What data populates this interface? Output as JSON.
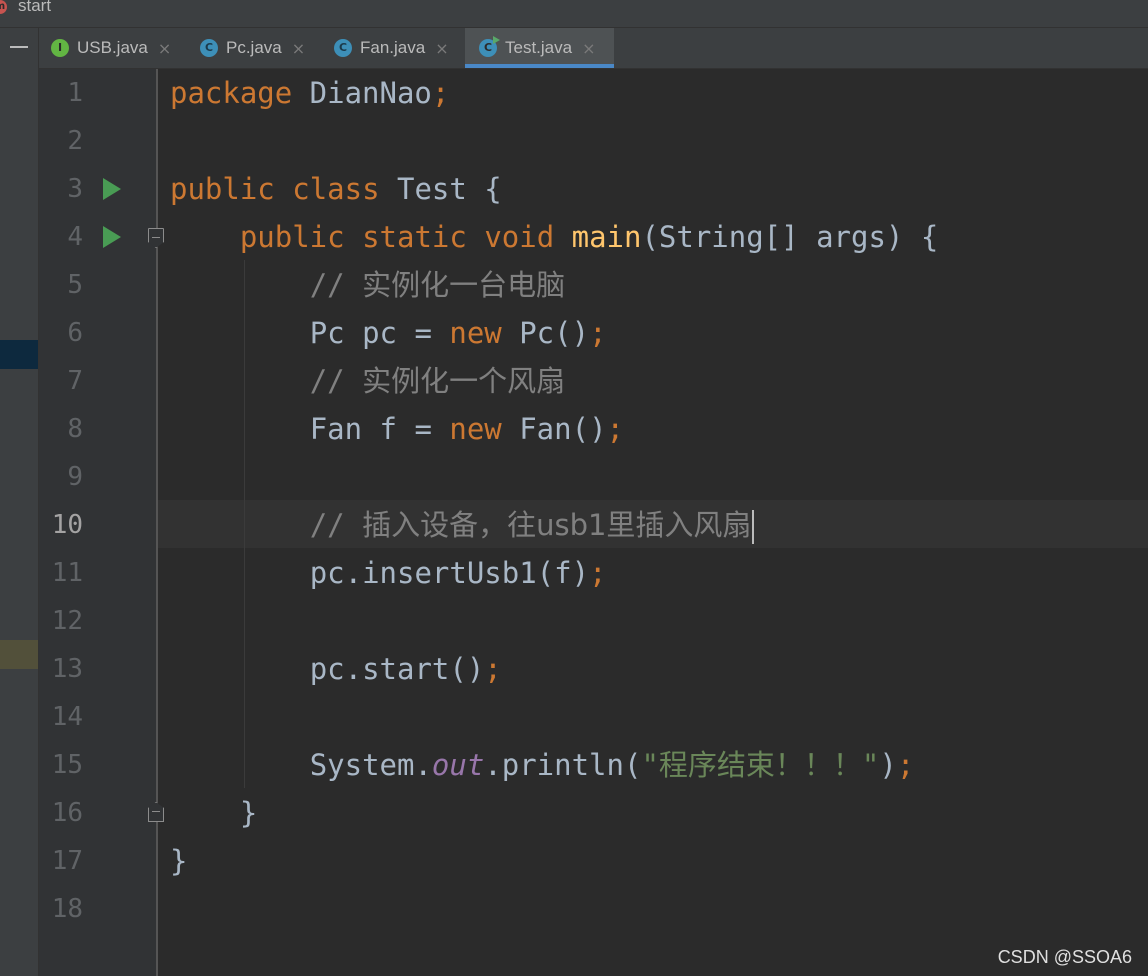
{
  "breadcrumb": {
    "label": "start",
    "icon": "method-icon"
  },
  "tabs": [
    {
      "label": "USB.java",
      "icon": "interface-icon",
      "letter": "I",
      "active": false
    },
    {
      "label": "Pc.java",
      "icon": "class-icon",
      "letter": "C",
      "active": false
    },
    {
      "label": "Fan.java",
      "icon": "class-icon",
      "letter": "C",
      "active": false
    },
    {
      "label": "Test.java",
      "icon": "runnable-class-icon",
      "letter": "C",
      "active": true
    }
  ],
  "close_glyph": "×",
  "line_numbers": [
    "1",
    "2",
    "3",
    "4",
    "5",
    "6",
    "7",
    "8",
    "9",
    "10",
    "11",
    "12",
    "13",
    "14",
    "15",
    "16",
    "17",
    "18"
  ],
  "current_line": "10",
  "code": {
    "l1": {
      "kw": "package",
      "rest": " DianNao",
      "semi": ";"
    },
    "l3": {
      "kw1": "public",
      "kw2": "class",
      "rest": " Test {"
    },
    "l4": {
      "kw1": "public",
      "kw2": "static",
      "kw3": "void",
      "fn": "main",
      "rest": "(String[] args) {"
    },
    "l5": {
      "slash": "// ",
      "comment": "实例化一台电脑"
    },
    "l6": {
      "pre": "Pc pc = ",
      "kw": "new",
      "post": " Pc()",
      "semi": ";"
    },
    "l7": {
      "slash": "// ",
      "comment": "实例化一个风扇"
    },
    "l8": {
      "pre": "Fan f = ",
      "kw": "new",
      "post": " Fan()",
      "semi": ";"
    },
    "l10": {
      "slash": "// ",
      "comment": "插入设备，往usb1里插入风扇"
    },
    "l11": {
      "pre": "pc.insertUsb1(f)",
      "semi": ";"
    },
    "l13": {
      "pre": "pc.start()",
      "semi": ";"
    },
    "l15": {
      "pre": "System.",
      "field": "out",
      "mid": ".println(",
      "str": "\"程序结束！！！\"",
      "post": ")",
      "semi": ";"
    },
    "l16": {
      "text": "}"
    },
    "l17": {
      "text": "}"
    }
  },
  "watermark": "CSDN @SSOA6",
  "colors": {
    "keyword": "#cc7832",
    "method_decl": "#ffc66d",
    "comment": "#808080",
    "string": "#6a8759",
    "static_field": "#9876aa",
    "default_text": "#a9b7c6",
    "run_icon": "#499c54",
    "active_tab_underline": "#4a88c7"
  }
}
